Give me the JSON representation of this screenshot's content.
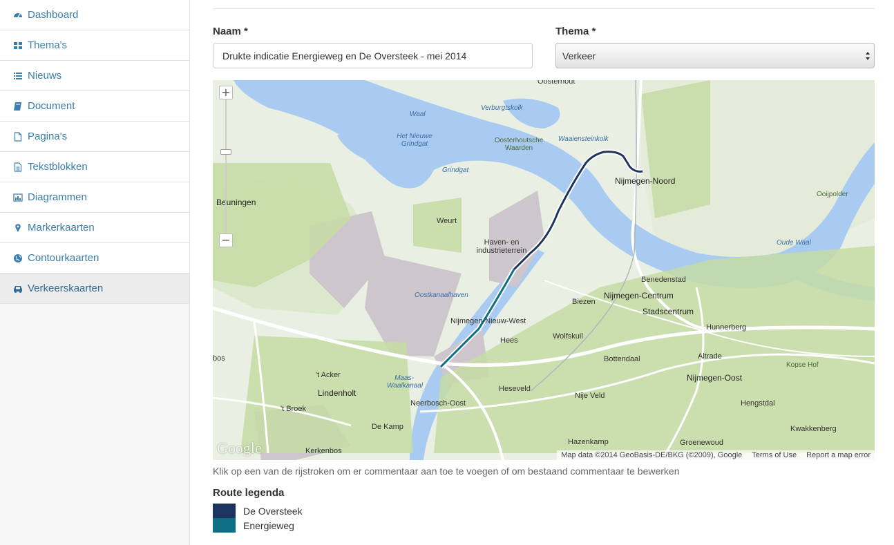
{
  "sidebar": {
    "items": [
      {
        "label": "Dashboard",
        "icon": "dashboard-icon"
      },
      {
        "label": "Thema's",
        "icon": "grid-icon"
      },
      {
        "label": "Nieuws",
        "icon": "list-icon"
      },
      {
        "label": "Document",
        "icon": "book-icon"
      },
      {
        "label": "Pagina's",
        "icon": "file-icon"
      },
      {
        "label": "Tekstblokken",
        "icon": "file-text-icon"
      },
      {
        "label": "Diagrammen",
        "icon": "bar-chart-icon"
      },
      {
        "label": "Markerkaarten",
        "icon": "map-marker-icon"
      },
      {
        "label": "Contourkaarten",
        "icon": "globe-icon"
      },
      {
        "label": "Verkeerskaarten",
        "icon": "car-icon"
      }
    ],
    "active": "Verkeerskaarten"
  },
  "form": {
    "name_label": "Naam *",
    "name_value": "Drukte indicatie Energieweg en De Oversteek - mei 2014",
    "theme_label": "Thema *",
    "theme_value": "Verkeer"
  },
  "map": {
    "zoom_in": "+",
    "zoom_out": "−",
    "google_logo": "Google",
    "attribution": "Map data ©2014 GeoBasis-DE/BKG (©2009), Google",
    "terms": "Terms of Use",
    "report": "Report a map error",
    "places": {
      "oosterhout": "Oosterhout",
      "waal": "Waal",
      "verburgtskolk": "Verburgtskolk",
      "het_nieuwe_grindgat": "Het Nieuwe Grindgat",
      "oosterhoutsche_waarden": "Oosterhoutsche Waarden",
      "waaiensteinkolk": "Waaiensteinkolk",
      "grindgat": "Grindgat",
      "nijmegen_noord": "Nijmegen-Noord",
      "ooijpolder": "Ooijpolder",
      "beuningen": "Beuningen",
      "weurt": "Weurt",
      "haven_industrieterrein": "Haven- en industrieterrein",
      "oude_waal": "Oude Waal",
      "benedenstad": "Benedenstad",
      "biezen": "Biezen",
      "nijmegen_centrum": "Nijmegen-Centrum",
      "oostkanaalhaven": "Oostkanaalhaven",
      "stadscentrum": "Stadscentrum",
      "nijmegen_nieuw_west": "Nijmegen-Nieuw-West",
      "hunnerberg": "Hunnerberg",
      "hees": "Hees",
      "wolfskuil": "Wolfskuil",
      "altrade": "Altrade",
      "bos": "bos",
      "bottendaal": "Bottendaal",
      "kopse_hof": "Kopse Hof",
      "t_acker": "'t Acker",
      "maas_waalkanaal": "Maas-Waalkanaal",
      "nijmegen_oost": "Nijmegen-Oost",
      "lindenholt": "Lindenholt",
      "heseveld": "Heseveld",
      "nije_veld": "Nije Veld",
      "neerbosch_oost": "Neerbosch-Oost",
      "hengstdal": "Hengstdal",
      "t_broek": "'t Broek",
      "de_kamp": "De Kamp",
      "kwakkenberg": "Kwakkenberg",
      "hazenkamp": "Hazenkamp",
      "groenewoud": "Groenewoud",
      "kerkenbos": "Kerkenbos"
    },
    "routes": [
      {
        "name": "De Oversteek",
        "color": "#1d3461"
      },
      {
        "name": "Energieweg",
        "color": "#0e6e84"
      }
    ]
  },
  "instructions": "Klik op een van de rijstroken om er commentaar aan toe te voegen of om bestaand commentaar te bewerken",
  "legend": {
    "title": "Route legenda",
    "items": [
      {
        "label": "De Oversteek",
        "color": "#1d3461"
      },
      {
        "label": "Energieweg",
        "color": "#0e6e84"
      }
    ]
  }
}
